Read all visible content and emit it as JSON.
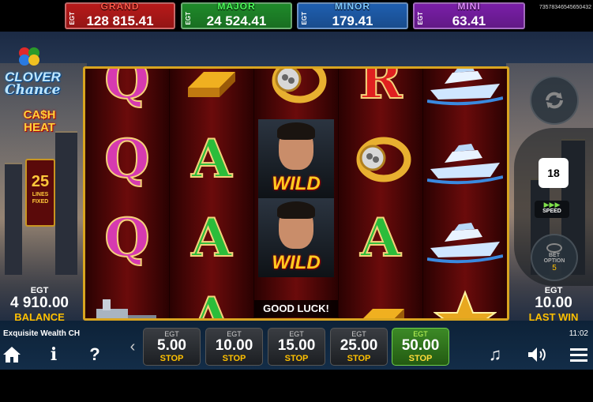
{
  "jackpots": [
    {
      "name": "GRAND",
      "value": "128 815.41",
      "color": "#b81a1a",
      "name_color": "#ff5a4a"
    },
    {
      "name": "MAJOR",
      "value": "24 524.41",
      "color": "#1f8a2a",
      "name_color": "#4cff5a"
    },
    {
      "name": "MINOR",
      "value": "179.41",
      "color": "#1f5fb0",
      "name_color": "#7ec8ff"
    },
    {
      "name": "MINI",
      "value": "63.41",
      "color": "#7a1fa8",
      "name_color": "#e08aff"
    }
  ],
  "jackpot_prefix": "EGT",
  "ticket_id": "73578346545650432",
  "logo": {
    "line1": "CLOVER",
    "line2": "Chance",
    "cash": "CA$H",
    "heat": "HEAT"
  },
  "lines": {
    "count": "25",
    "label1": "LINES",
    "label2": "FIXED"
  },
  "balance": {
    "currency": "EGT",
    "amount": "4 910.00",
    "label": "BALANCE"
  },
  "last_win": {
    "currency": "EGT",
    "amount": "10.00",
    "label": "LAST WIN"
  },
  "reels": [
    [
      "Q",
      "Q",
      "Q",
      "machine"
    ],
    [
      "gold",
      "A",
      "A",
      "A"
    ],
    [
      "ring",
      "wild",
      "wild",
      "good"
    ],
    [
      "R",
      "ring",
      "A",
      "gold"
    ],
    [
      "yacht",
      "yacht",
      "yacht",
      "star"
    ]
  ],
  "wild_text": "WILD",
  "status_message": "GOOD LUCK!",
  "autoplay_count": "18",
  "speed_label": "SPEED",
  "bet_option": {
    "label1": "BET",
    "label2": "OPTION",
    "value": "5"
  },
  "game_name": "Exquisite Wealth CH",
  "clock": "11:02",
  "bets": [
    {
      "currency": "EGT",
      "amount": "5.00",
      "action": "STOP",
      "active": false
    },
    {
      "currency": "EGT",
      "amount": "10.00",
      "action": "STOP",
      "active": false
    },
    {
      "currency": "EGT",
      "amount": "15.00",
      "action": "STOP",
      "active": false
    },
    {
      "currency": "EGT",
      "amount": "25.00",
      "action": "STOP",
      "active": false
    },
    {
      "currency": "EGT",
      "amount": "50.00",
      "action": "STOP",
      "active": true
    }
  ],
  "icons": [
    "home-icon",
    "info-icon",
    "help-icon",
    "music-icon",
    "volume-icon",
    "menu-icon",
    "autoplay-icon",
    "speed-icon",
    "bet-option-icon",
    "scroll-left-icon"
  ]
}
